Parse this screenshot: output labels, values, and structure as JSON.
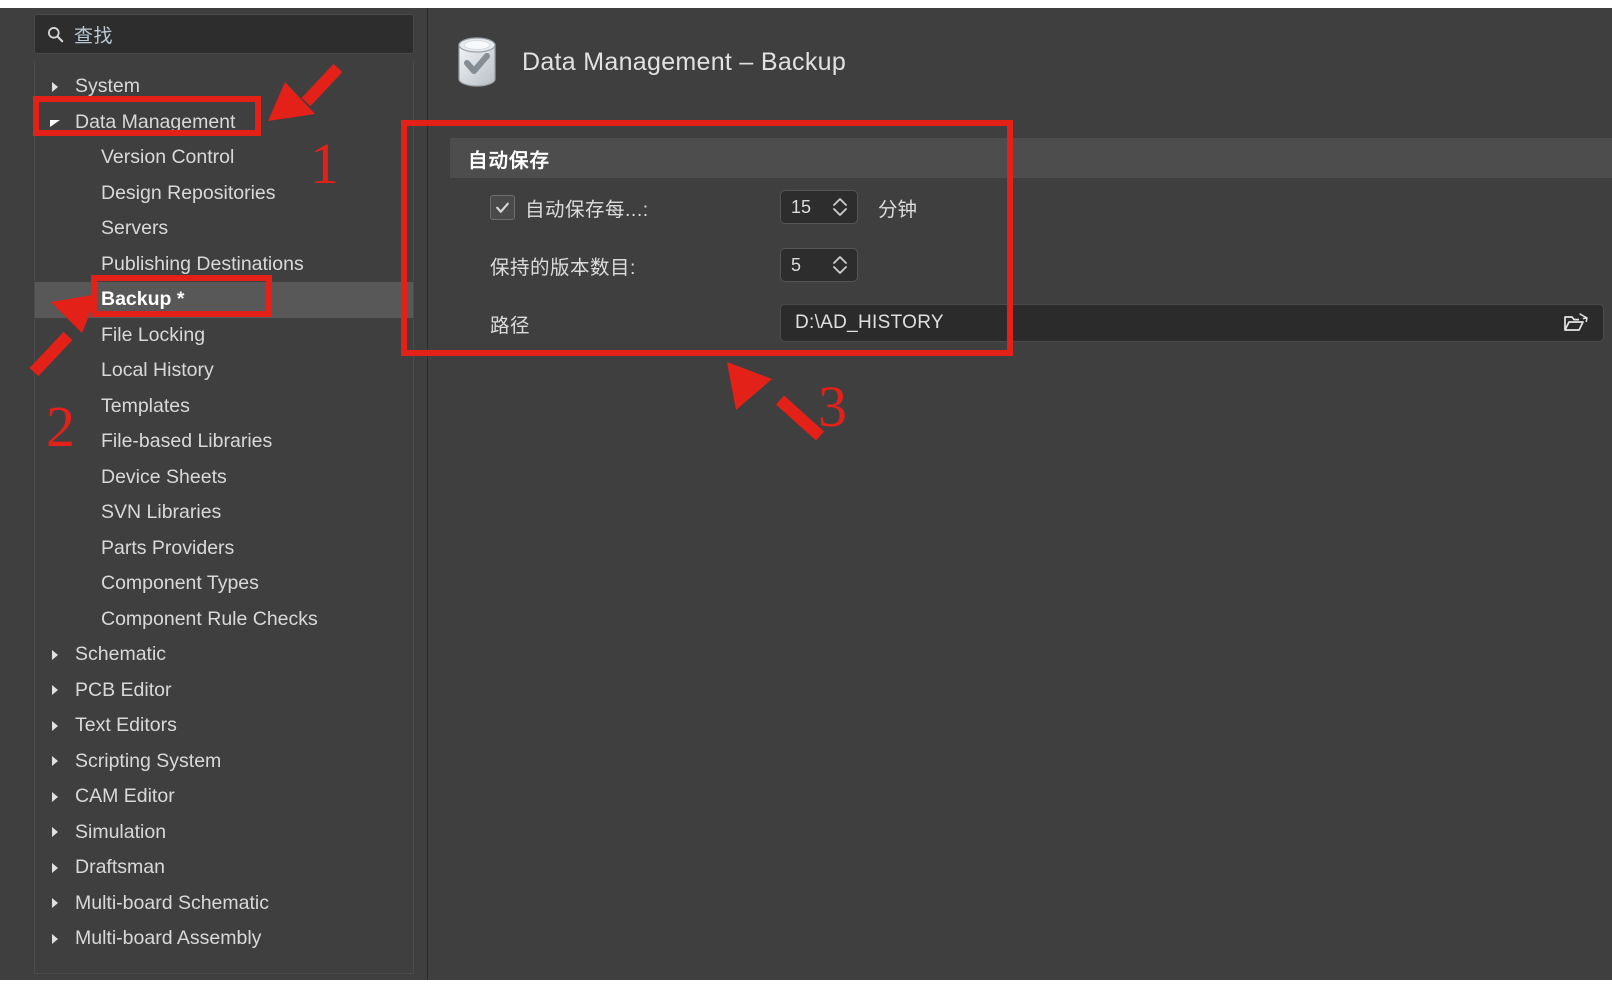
{
  "window": {
    "title": "Data Management – Backup",
    "title_icon": "database-check-icon",
    "accent_color": "#e32119",
    "bg_color": "#3f3f3f",
    "panel_header_color": "#4d4d4d",
    "selected_row_color": "#585858"
  },
  "search": {
    "placeholder": "查找",
    "value": "",
    "icon": "search-icon"
  },
  "sidebar": {
    "items": [
      {
        "label": "System",
        "level": "top",
        "caret": "collapsed",
        "selected": false
      },
      {
        "label": "Data Management",
        "level": "top",
        "caret": "expanded",
        "selected": false
      },
      {
        "label": "Version Control",
        "level": "child",
        "caret": "none",
        "selected": false
      },
      {
        "label": "Design Repositories",
        "level": "child",
        "caret": "none",
        "selected": false
      },
      {
        "label": "Servers",
        "level": "child",
        "caret": "none",
        "selected": false
      },
      {
        "label": "Publishing Destinations",
        "level": "child",
        "caret": "none",
        "selected": false
      },
      {
        "label": "Backup *",
        "level": "child",
        "caret": "none",
        "selected": true
      },
      {
        "label": "File Locking",
        "level": "child",
        "caret": "none",
        "selected": false
      },
      {
        "label": "Local History",
        "level": "child",
        "caret": "none",
        "selected": false
      },
      {
        "label": "Templates",
        "level": "child",
        "caret": "none",
        "selected": false
      },
      {
        "label": "File-based Libraries",
        "level": "child",
        "caret": "none",
        "selected": false
      },
      {
        "label": "Device Sheets",
        "level": "child",
        "caret": "none",
        "selected": false
      },
      {
        "label": "SVN Libraries",
        "level": "child",
        "caret": "none",
        "selected": false
      },
      {
        "label": "Parts Providers",
        "level": "child",
        "caret": "none",
        "selected": false
      },
      {
        "label": "Component Types",
        "level": "child",
        "caret": "none",
        "selected": false
      },
      {
        "label": "Component Rule Checks",
        "level": "child",
        "caret": "none",
        "selected": false
      },
      {
        "label": "Schematic",
        "level": "top",
        "caret": "collapsed",
        "selected": false
      },
      {
        "label": "PCB Editor",
        "level": "top",
        "caret": "collapsed",
        "selected": false
      },
      {
        "label": "Text Editors",
        "level": "top",
        "caret": "collapsed",
        "selected": false
      },
      {
        "label": "Scripting System",
        "level": "top",
        "caret": "collapsed",
        "selected": false
      },
      {
        "label": "CAM Editor",
        "level": "top",
        "caret": "collapsed",
        "selected": false
      },
      {
        "label": "Simulation",
        "level": "top",
        "caret": "collapsed",
        "selected": false
      },
      {
        "label": "Draftsman",
        "level": "top",
        "caret": "collapsed",
        "selected": false
      },
      {
        "label": "Multi-board Schematic",
        "level": "top",
        "caret": "collapsed",
        "selected": false
      },
      {
        "label": "Multi-board Assembly",
        "level": "top",
        "caret": "collapsed",
        "selected": false
      }
    ]
  },
  "main": {
    "section_title": "自动保存",
    "autosave": {
      "checkbox_label": "自动保存每...:",
      "checked": true,
      "interval_value": "15",
      "interval_unit": "分钟"
    },
    "versions": {
      "label": "保持的版本数目:",
      "value": "5"
    },
    "path": {
      "label": "路径",
      "value": "D:\\AD_HISTORY",
      "browse_icon": "folder-open-icon"
    }
  },
  "annotations": [
    {
      "number": "1",
      "target": "Data Management sidebar entry"
    },
    {
      "number": "2",
      "target": "Backup * sidebar entry"
    },
    {
      "number": "3",
      "target": "自动保存 settings group"
    }
  ]
}
